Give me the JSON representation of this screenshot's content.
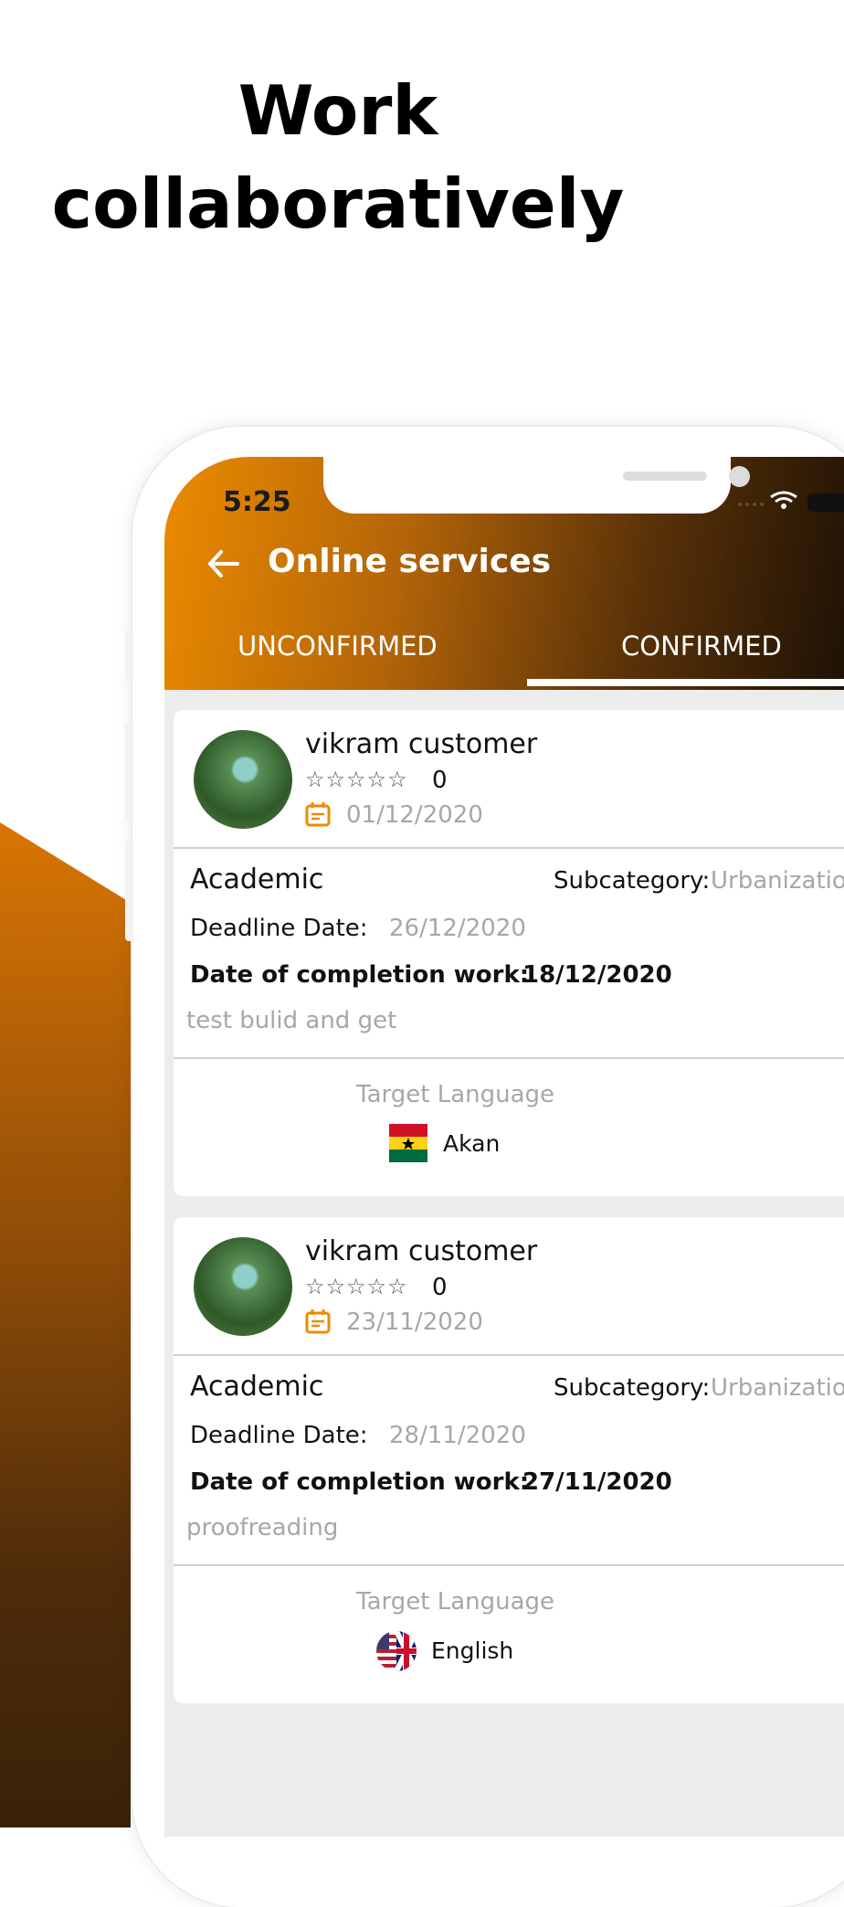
{
  "headline": {
    "line1": "Work",
    "line2": "collaboratively"
  },
  "status_bar": {
    "time": "5:25"
  },
  "app_bar": {
    "title": "Online services"
  },
  "tabs": [
    {
      "label": "UNCONFIRMED"
    },
    {
      "label": "CONFIRMED",
      "selected": true
    }
  ],
  "colors": {
    "accent": "#EC8B00",
    "bar_dark": "#1A0F05",
    "muted_text": "#A7A7A7"
  },
  "icons": {
    "back": "arrow-left-icon",
    "date": "calendar-icon",
    "rating": "star-icon"
  },
  "cards": [
    {
      "customer": "vikram customer",
      "stars": "☆☆☆☆☆",
      "rating": "0",
      "date": "01/12/2020",
      "category": "Academic",
      "subcategory_label": "Subcategory:",
      "subcategory": "Urbanizatio",
      "deadline_label": "Deadline Date:",
      "deadline": "26/12/2020",
      "completion_label": "Date of completion work:",
      "completion": "18/12/2020",
      "note": "test bulid and get",
      "target_label": "Target Language",
      "language": "Akan",
      "flag": "ghana-flag-icon"
    },
    {
      "customer": "vikram customer",
      "stars": "☆☆☆☆☆",
      "rating": "0",
      "date": "23/11/2020",
      "category": "Academic",
      "subcategory_label": "Subcategory:",
      "subcategory": "Urbanizatio",
      "deadline_label": "Deadline Date:",
      "deadline": "28/11/2020",
      "completion_label": "Date of completion work:",
      "completion": "27/11/2020",
      "note": "proofreading",
      "target_label": "Target Language",
      "language": "English",
      "flag": "usa-uk-flag-icon"
    }
  ]
}
